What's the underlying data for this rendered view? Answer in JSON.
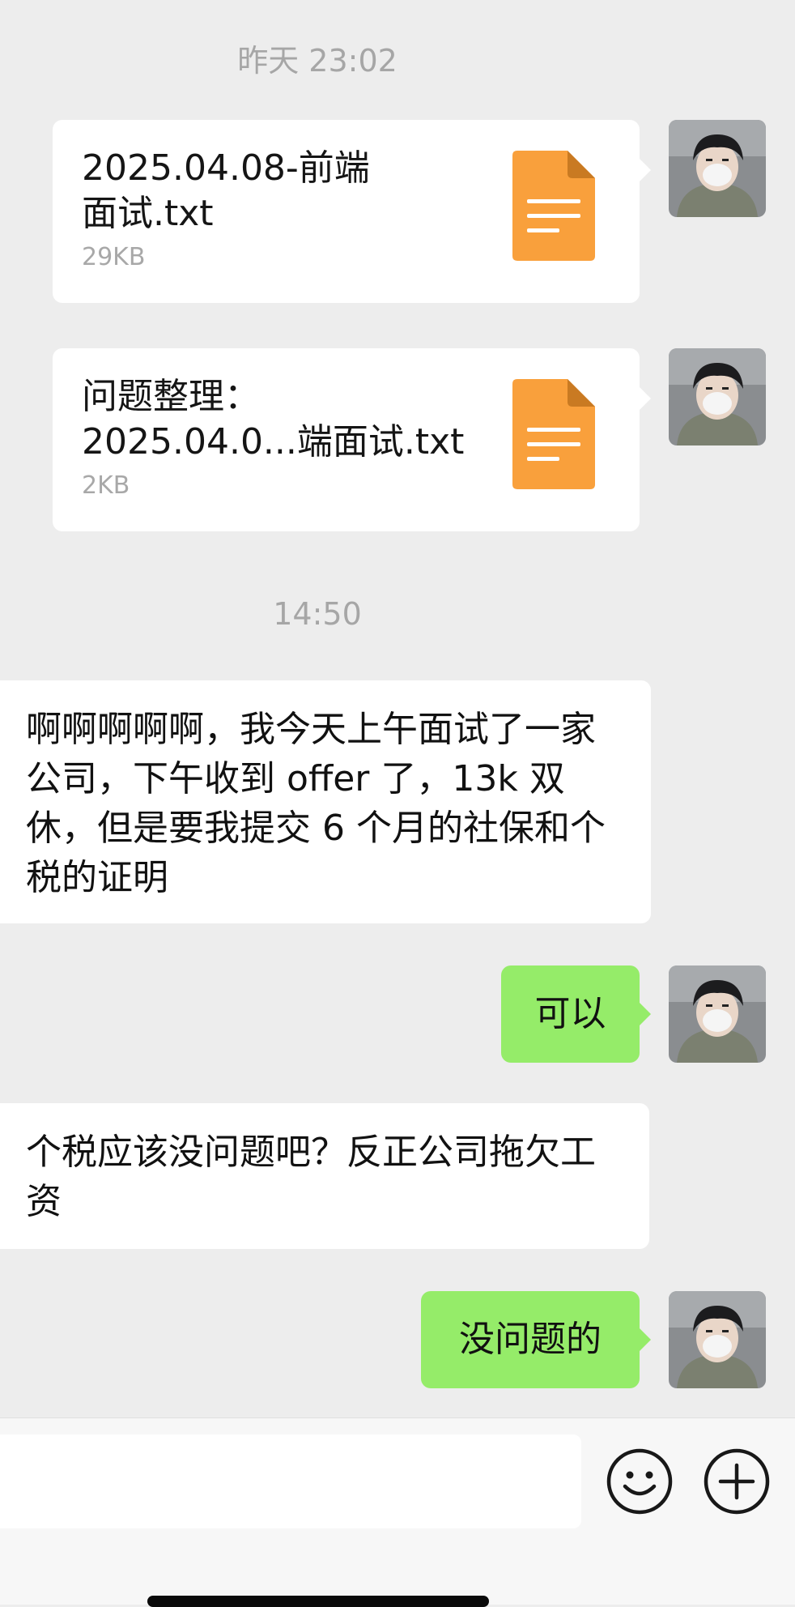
{
  "chat": {
    "timestamps": [
      "昨天 23:02",
      "14:50"
    ],
    "files": [
      {
        "name": "2025.04.08-前端\n面试.txt",
        "size": "29KB",
        "icon": "document-icon"
      },
      {
        "name": "问题整理：\n2025.04.0...端面试.txt",
        "size": "2KB",
        "icon": "document-icon"
      }
    ],
    "messages": [
      {
        "from": "other",
        "text": "啊啊啊啊啊，我今天上午面试了一家公司，下午收到 offer 了，13k 双休，但是要我提交 6 个月的社保和个税的证明"
      },
      {
        "from": "self",
        "text": "可以"
      },
      {
        "from": "other",
        "text": "个税应该没问题吧？反正公司拖欠工资"
      },
      {
        "from": "self",
        "text": "没问题的"
      }
    ]
  },
  "input_bar": {
    "value": "",
    "emoji_icon": "smiley-icon",
    "plus_icon": "plus-circle-icon"
  },
  "colors": {
    "background": "#ededed",
    "self_bubble": "#95ec69",
    "other_bubble": "#ffffff",
    "file_icon": "#f9a03c",
    "timestamp": "#a6a6a6"
  }
}
